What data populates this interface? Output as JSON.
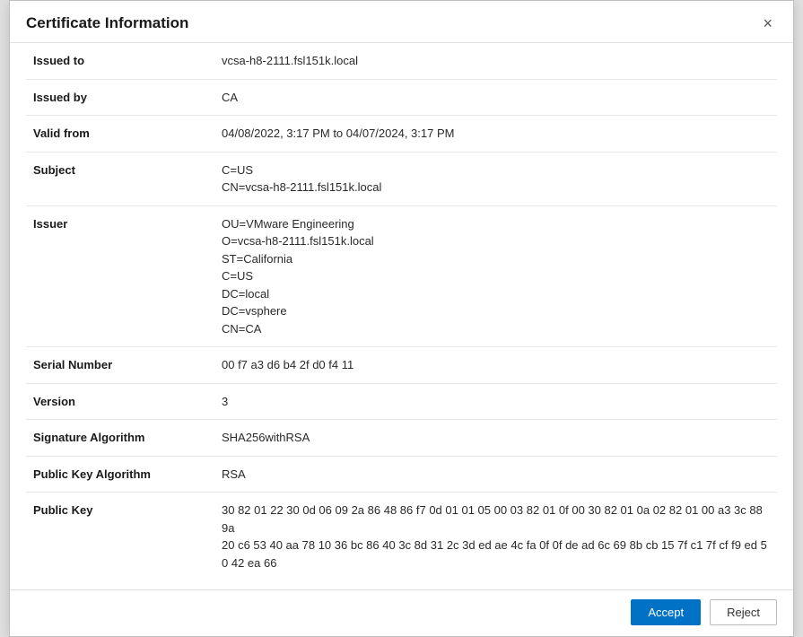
{
  "dialog": {
    "title": "Certificate Information",
    "close_label": "×"
  },
  "fields": [
    {
      "label": "Issued to",
      "value": "vcsa-h8-2111.fsl151k.local"
    },
    {
      "label": "Issued by",
      "value": "CA"
    },
    {
      "label": "Valid from",
      "value": "04/08/2022, 3:17 PM to 04/07/2024, 3:17 PM"
    },
    {
      "label": "Subject",
      "value": "C=US\nCN=vcsa-h8-2111.fsl151k.local"
    },
    {
      "label": "Issuer",
      "value": "OU=VMware Engineering\nO=vcsa-h8-2111.fsl151k.local\nST=California\nC=US\nDC=local\nDC=vsphere\nCN=CA"
    },
    {
      "label": "Serial Number",
      "value": "00 f7 a3 d6 b4 2f d0 f4 11"
    },
    {
      "label": "Version",
      "value": "3"
    },
    {
      "label": "Signature Algorithm",
      "value": "SHA256withRSA"
    },
    {
      "label": "Public Key Algorithm",
      "value": "RSA"
    },
    {
      "label": "Public Key",
      "value": "30 82 01 22 30 0d 06 09 2a 86 48 86 f7 0d 01 01 05 00 03 82 01 0f 00 30 82 01 0a 02 82 01 00 a3 3c 88 9a\n20 c6 53 40 aa 78 10 36 bc 86 40 3c 8d 31 2c 3d ed ae 4c fa 0f 0f de ad 6c 69 8b cb 15 7f c1 7f cf f9 ed 50 42 ea 66"
    }
  ],
  "footer": {
    "accept_label": "Accept",
    "reject_label": "Reject"
  }
}
